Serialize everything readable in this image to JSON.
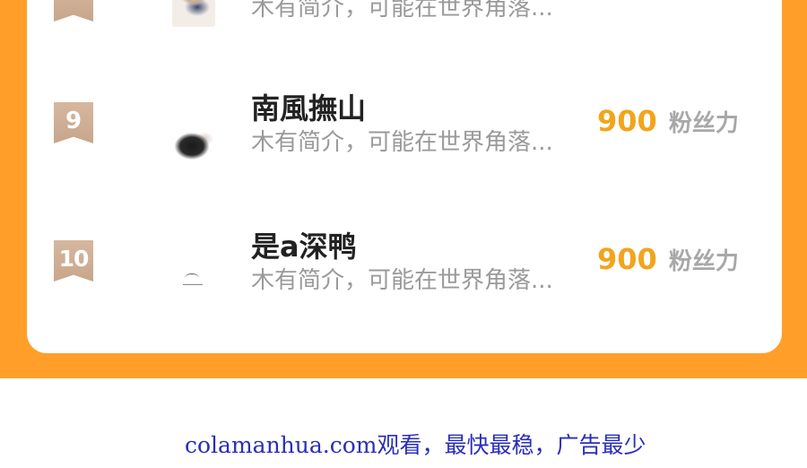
{
  "ranking": {
    "partial_row": {
      "bio": "木有简介，可能在世界角落..."
    },
    "rows": [
      {
        "rank": "9",
        "name": "南風撫山",
        "bio": "木有简介，可能在世界角落...",
        "fans_count": "900",
        "fans_label": "粉丝力"
      },
      {
        "rank": "10",
        "name": "是a深鸭",
        "bio": "木有简介，可能在世界角落...",
        "fans_count": "900",
        "fans_label": "粉丝力"
      }
    ]
  },
  "footer": {
    "text": "colamanhua.com观看，最快最稳，广告最少"
  },
  "colors": {
    "accent_orange": "#ff9f2a",
    "fans_count": "#f1a51c",
    "badge": "#c7a68b",
    "footer_text": "#2a2fb8"
  }
}
